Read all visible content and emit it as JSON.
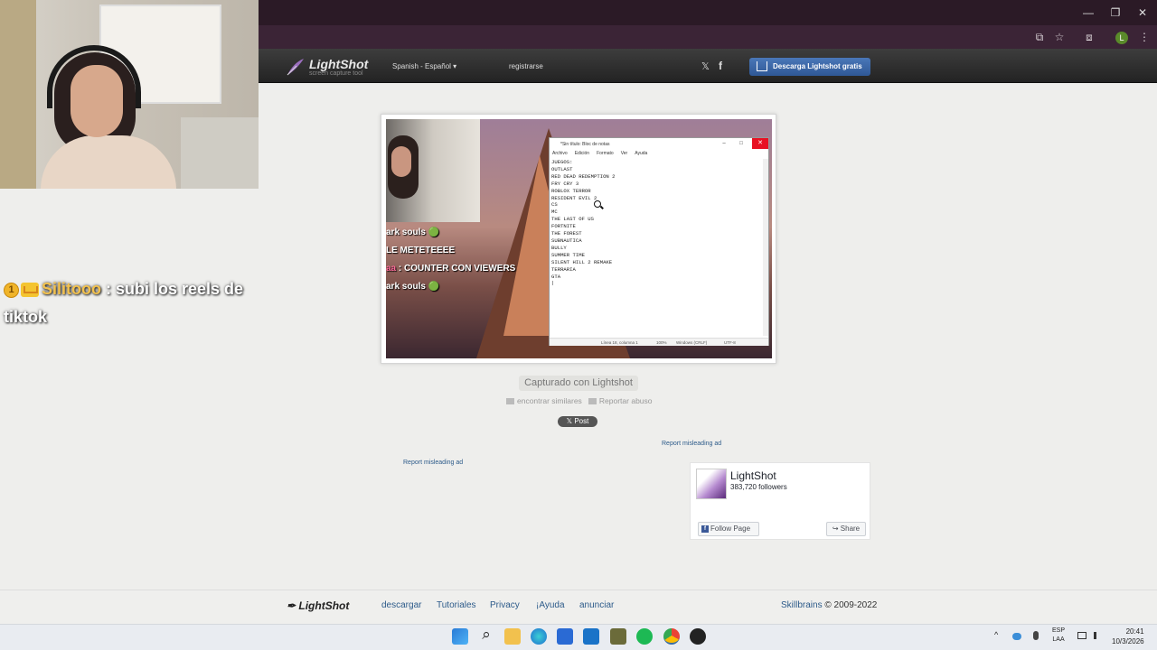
{
  "window": {
    "minimize": "—",
    "restore": "❐",
    "close": "✕"
  },
  "toolbar": {
    "cast_icon": "⧉",
    "star_icon": "☆",
    "ext_icon": "⧈",
    "profile": "L",
    "menu_icon": "⋮"
  },
  "header": {
    "logo": "LightShot",
    "tagline": "screen capture tool",
    "language": "Spanish - Español ▾",
    "register": "registrarse",
    "twitter": "𝕏",
    "facebook": "f",
    "download_btn": "Descarga Lightshot gratis"
  },
  "screenshot": {
    "chat_lines": [
      "ark souls 🟢",
      "LE METETEEEE",
      "aa",
      ": COUNTER CON VIEWERS",
      "ark souls 🟢"
    ],
    "notepad": {
      "title": "*Sin título: Bloc de notas",
      "menu": [
        "Archivo",
        "Edición",
        "Formato",
        "Ver",
        "Ayuda"
      ],
      "lines": [
        "JUEGOS:",
        "OUTLAST",
        "RED DEAD REDEMPTION 2",
        "FRY CRY 3",
        "ROBLOX TERROR",
        "RESIDENT EVIL 2",
        "CS",
        "MC",
        "THE LAST OF US",
        "FORTNITE",
        "THE FOREST",
        "SUBNAUTICA",
        "BULLY",
        "SUMMER TIME",
        "SILENT HILL 2 REMAKE",
        "TERRARIA",
        "GTA",
        "|"
      ],
      "status": {
        "position": "Línea 18, columna 1",
        "zoom": "100%",
        "eol": "Windows (CRLF)",
        "encoding": "UTF-8"
      }
    }
  },
  "page": {
    "captured": "Capturado con Lightshot",
    "find_similar": "encontrar similares",
    "report_abuse": "Reportar abuso",
    "post": "𝕏 Post",
    "report_ad_1": "Report misleading ad",
    "report_ad_2": "Report misleading ad"
  },
  "fb_widget": {
    "name": "LightShot",
    "followers": "383,720 followers",
    "follow": "Follow Page",
    "share": "↪ Share"
  },
  "chat_overlay": {
    "badge": "1",
    "username": "Silitooo",
    "message": ": subi los reels de tiktok"
  },
  "footer": {
    "logo": "LightShot",
    "links": [
      "descargar",
      "Tutoriales",
      "Privacy",
      "¡Ayuda",
      "anunciar"
    ],
    "company": "Skillbrains",
    "copyright": "© 2009-2022"
  },
  "taskbar": {
    "lang_1": "ESP",
    "lang_2": "LAA",
    "time": "20:41",
    "date": "10/3/2026",
    "search_icon": "⌕",
    "tray_chevron": "^"
  }
}
